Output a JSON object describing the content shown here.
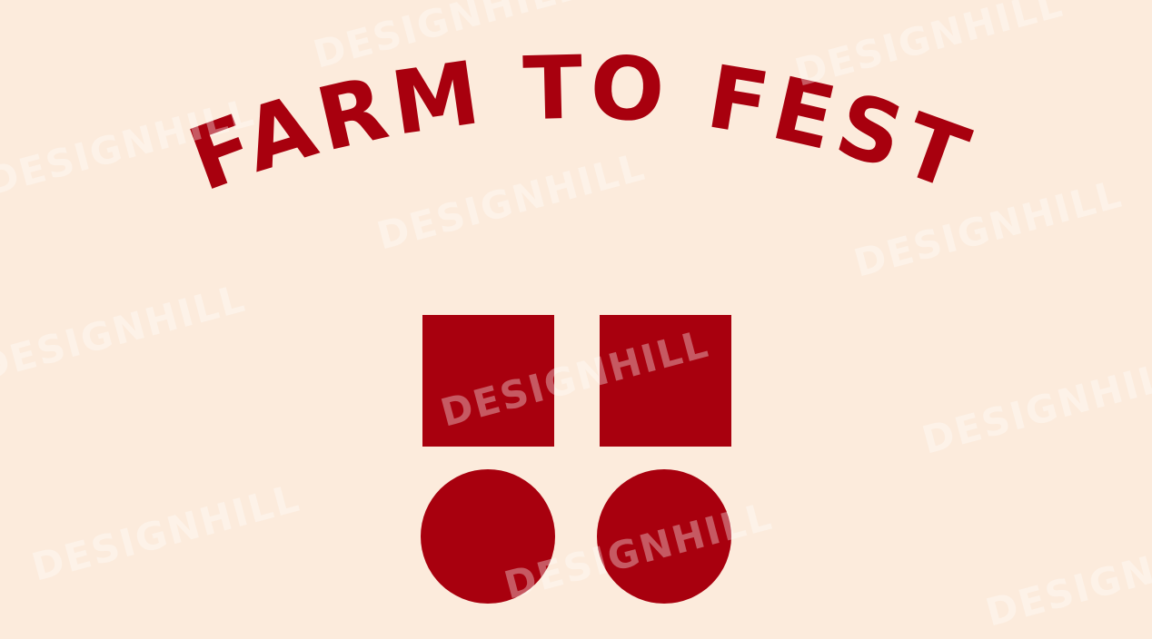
{
  "logo": {
    "title": "FARM TO FEST",
    "color": "#a8000e"
  },
  "watermark": {
    "text": "DESIGNHILL",
    "color": "#ffffff"
  },
  "background_color": "#fcebdc"
}
